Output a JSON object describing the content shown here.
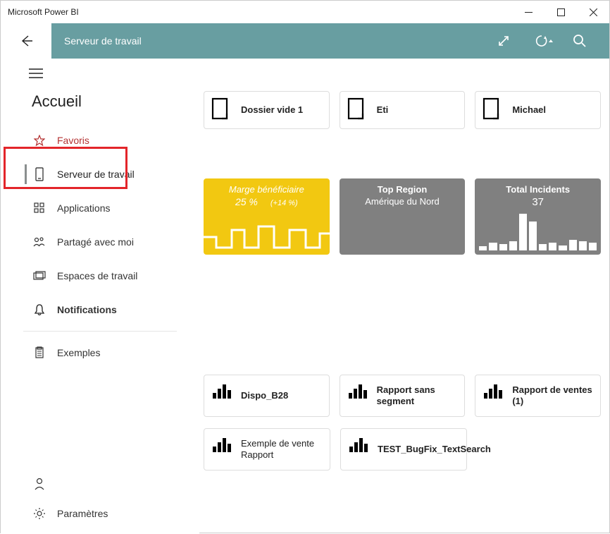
{
  "window": {
    "title": "Microsoft Power BI"
  },
  "topbar": {
    "label": "Serveur de travail"
  },
  "sidebar": {
    "section_title": "Accueil",
    "items": {
      "favoris": "Favoris",
      "serveur": "Serveur de travail",
      "applications": "Applications",
      "partage": "Partagé avec moi",
      "espaces": "Espaces de travail",
      "notifications": "Notifications",
      "exemples": "Exemples",
      "settings": "Paramètres"
    }
  },
  "folders": [
    {
      "label": "Dossier vide 1"
    },
    {
      "label": "Eti"
    },
    {
      "label": "Michael"
    }
  ],
  "kpis": {
    "marge": {
      "title": "Marge bénéficiaire",
      "value": "25 %",
      "delta": "(+14 %)"
    },
    "region": {
      "title": "Top Region",
      "value": "Amérique du Nord"
    },
    "incidents": {
      "title": "Total Incidents",
      "value": "37"
    }
  },
  "reports": [
    {
      "label": "Dispo_B28"
    },
    {
      "label": "Rapport sans segment"
    },
    {
      "label": "Rapport de ventes (1)"
    },
    {
      "label": "Exemple de vente Rapport"
    },
    {
      "label": "TEST_BugFix_TextSearch"
    }
  ],
  "chart_data": {
    "type": "bar",
    "title": "Total Incidents",
    "values": [
      3,
      6,
      5,
      7,
      28,
      22,
      5,
      6,
      4,
      8,
      7,
      6
    ],
    "ylim": [
      0,
      30
    ]
  }
}
